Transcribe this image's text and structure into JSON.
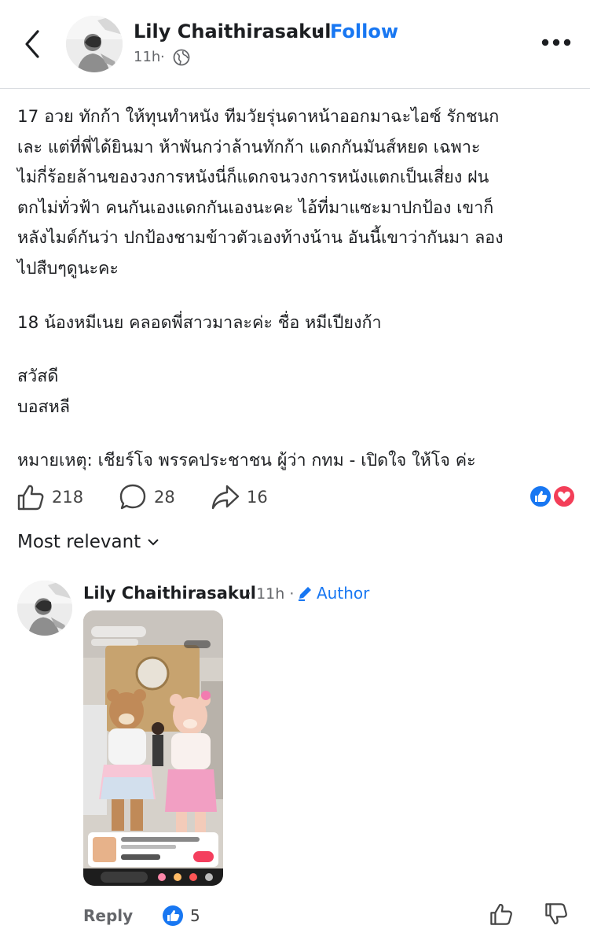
{
  "header": {
    "name": "Lily Chaithirasakul",
    "dot": "·",
    "follow": "Follow",
    "time": "11h",
    "sep": "·"
  },
  "post": {
    "lines_a": [
      "17 อวย ทักก้า ให้ทุนทำหนัง ทีมวัยรุ่นดาหน้าออกมาฉะไอซ์ รักชนก",
      "เละ แต่ที่พี่ได้ยินมา ห้าพันกว่าล้านทักก้า แดกกันมันส์หยด เฉพาะ",
      "ไม่กี่ร้อยล้านของวงการหนังนี่ก็แดกจนวงการหนังแตกเป็นเสี่ยง ฝน",
      "ตกไม่ทั่วฟ้า คนกันเองแดกกันเองนะคะ ไอ้ที่มาแซะมาปกป้อง เขาก็",
      "หลังไมด์กันว่า ปกป้องชามข้าวตัวเองท้างน้าน อันนี้เขาว่ากันมา ลอง",
      "ไปสืบๆดูนะคะ"
    ],
    "line_b": "18 น้องหมีเนย คลอดพี่สาวมาละค่ะ ชื่อ หมีเปียงก้า",
    "lines_c": [
      "สวัสดี",
      "บอสหลี"
    ],
    "line_d": "หมายเหตุ: เชียร์โจ พรรคประชาชน ผู้ว่า กทม - เปิดใจ ให้โจ ค่ะ"
  },
  "actions": {
    "likes": "218",
    "comments": "28",
    "shares": "16"
  },
  "sort": {
    "label": "Most relevant"
  },
  "comment": {
    "name": "Lily Chaithirasakul",
    "meta": "· 11h ·",
    "author": "Author",
    "reply": "Reply",
    "likes": "5"
  },
  "colors": {
    "accent": "#1877f2",
    "love": "#f33e58",
    "text": "#1c1e21",
    "muted": "#65676b"
  },
  "icons": {
    "back": "chevron-left-icon",
    "globe": "globe-icon",
    "more": "more-icon",
    "like": "thumb-up-icon",
    "comment": "comment-icon",
    "share": "share-icon",
    "edit": "pencil-icon",
    "dislike": "thumb-down-icon"
  }
}
